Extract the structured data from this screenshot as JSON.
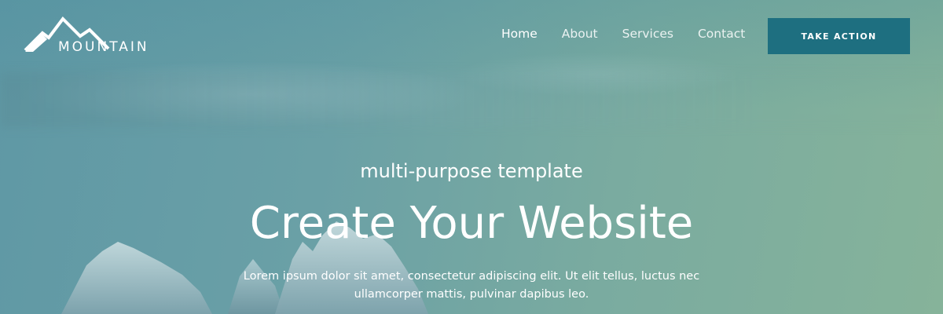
{
  "brand": {
    "name": "MOUNTAIN",
    "logo_icon": "mountain-peaks-icon"
  },
  "nav": {
    "items": [
      {
        "label": "Home",
        "active": true
      },
      {
        "label": "About",
        "active": false
      },
      {
        "label": "Services",
        "active": false
      },
      {
        "label": "Contact",
        "active": false
      }
    ],
    "cta_label": "TAKE ACTION"
  },
  "hero": {
    "subtitle": "multi-purpose template",
    "headline": "Create Your Website",
    "body": "Lorem ipsum dolor sit amet, consectetur adipiscing elit. Ut elit tellus, luctus nec ullamcorper mattis, pulvinar dapibus leo."
  },
  "colors": {
    "cta_background": "#1e6f80",
    "text": "#ffffff",
    "sky_left": "#5f98a5",
    "sky_right": "#86b39a"
  }
}
